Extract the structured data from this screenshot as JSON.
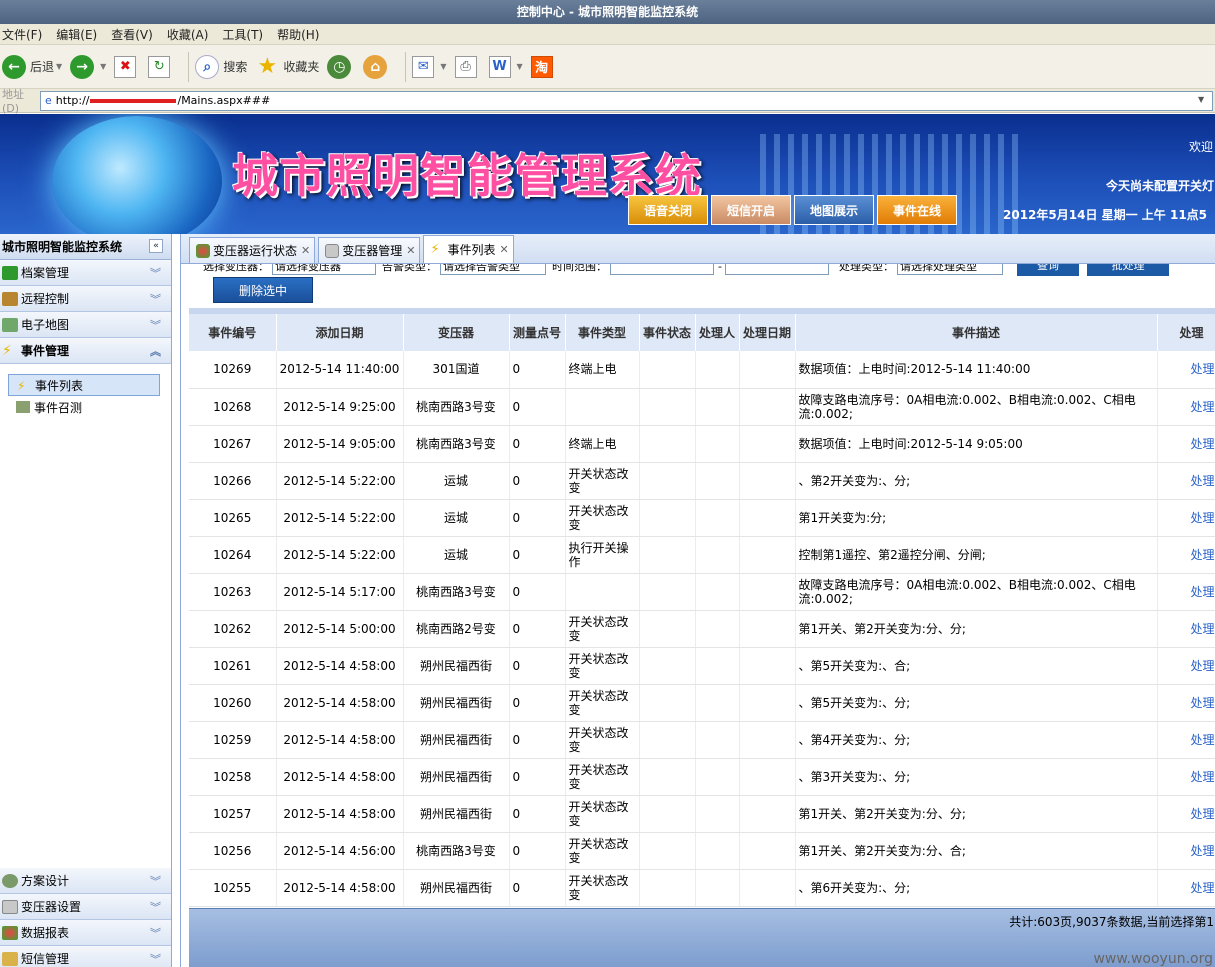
{
  "window": {
    "title": "控制中心 - 城市照明智能监控系统"
  },
  "menu": [
    "文件(F)",
    "编辑(E)",
    "查看(V)",
    "收藏(A)",
    "工具(T)",
    "帮助(H)"
  ],
  "toolbar": {
    "back": "后退",
    "search": "搜索",
    "favorites": "收藏夹"
  },
  "address": {
    "label": "地址(D)",
    "prefix": "http://",
    "suffix": "/Mains.aspx###"
  },
  "banner": {
    "title": "城市照明智能管理系统",
    "welcome": "欢迎",
    "notice": "今天尚未配置开关灯",
    "date": "2012年5月14日 星期一 上午 11点5",
    "buttons": [
      "语音关闭",
      "短信开启",
      "地图展示",
      "事件在线"
    ]
  },
  "sidebar": {
    "title": "城市照明智能监控系统",
    "sections_top": [
      "档案管理",
      "远程控制",
      "电子地图",
      "事件管理"
    ],
    "tree": [
      "事件列表",
      "事件召测"
    ],
    "sections_bottom": [
      "方案设计",
      "变压器设置",
      "数据报表",
      "短信管理"
    ]
  },
  "tabs": [
    "变压器运行状态",
    "变压器管理",
    "事件列表"
  ],
  "filter": {
    "l1": "选择变压器：",
    "s1": "请选择变压器",
    "l2": "告警类型：",
    "s2": "请选择告警类型",
    "l3": "时间范围：",
    "dash": "-",
    "l4": "处理类型：",
    "s4": "请选择处理类型",
    "query": "查询",
    "batch": "批处理",
    "delete": "删除选中"
  },
  "table": {
    "headers": [
      "事件编号",
      "添加日期",
      "变压器",
      "测量点号",
      "事件类型",
      "事件状态",
      "处理人",
      "处理日期",
      "事件描述",
      "处理"
    ],
    "rows": [
      [
        "10269",
        "2012-5-14 11:40:00",
        "301国道",
        "0",
        "终端上电",
        "",
        "",
        "",
        "数据项值：上电时间:2012-5-14 11:40:00",
        "处理"
      ],
      [
        "10268",
        "2012-5-14 9:25:00",
        "桃南西路3号变",
        "0",
        "",
        "",
        "",
        "",
        "故障支路电流序号：0A相电流:0.002、B相电流:0.002、C相电流:0.002;",
        "处理"
      ],
      [
        "10267",
        "2012-5-14 9:05:00",
        "桃南西路3号变",
        "0",
        "终端上电",
        "",
        "",
        "",
        "数据项值：上电时间:2012-5-14 9:05:00",
        "处理"
      ],
      [
        "10266",
        "2012-5-14 5:22:00",
        "运城",
        "0",
        "开关状态改变",
        "",
        "",
        "",
        "、第2开关变为:、分;",
        "处理"
      ],
      [
        "10265",
        "2012-5-14 5:22:00",
        "运城",
        "0",
        "开关状态改变",
        "",
        "",
        "",
        "第1开关变为:分;",
        "处理"
      ],
      [
        "10264",
        "2012-5-14 5:22:00",
        "运城",
        "0",
        "执行开关操作",
        "",
        "",
        "",
        "控制第1遥控、第2遥控分闸、分闸;",
        "处理"
      ],
      [
        "10263",
        "2012-5-14 5:17:00",
        "桃南西路3号变",
        "0",
        "",
        "",
        "",
        "",
        "故障支路电流序号：0A相电流:0.002、B相电流:0.002、C相电流:0.002;",
        "处理"
      ],
      [
        "10262",
        "2012-5-14 5:00:00",
        "桃南西路2号变",
        "0",
        "开关状态改变",
        "",
        "",
        "",
        "第1开关、第2开关变为:分、分;",
        "处理"
      ],
      [
        "10261",
        "2012-5-14 4:58:00",
        "朔州民福西街",
        "0",
        "开关状态改变",
        "",
        "",
        "",
        "、第5开关变为:、合;",
        "处理"
      ],
      [
        "10260",
        "2012-5-14 4:58:00",
        "朔州民福西街",
        "0",
        "开关状态改变",
        "",
        "",
        "",
        "、第5开关变为:、分;",
        "处理"
      ],
      [
        "10259",
        "2012-5-14 4:58:00",
        "朔州民福西街",
        "0",
        "开关状态改变",
        "",
        "",
        "",
        "、第4开关变为:、分;",
        "处理"
      ],
      [
        "10258",
        "2012-5-14 4:58:00",
        "朔州民福西街",
        "0",
        "开关状态改变",
        "",
        "",
        "",
        "、第3开关变为:、分;",
        "处理"
      ],
      [
        "10257",
        "2012-5-14 4:58:00",
        "朔州民福西街",
        "0",
        "开关状态改变",
        "",
        "",
        "",
        "第1开关、第2开关变为:分、分;",
        "处理"
      ],
      [
        "10256",
        "2012-5-14 4:56:00",
        "桃南西路3号变",
        "0",
        "开关状态改变",
        "",
        "",
        "",
        "第1开关、第2开关变为:分、合;",
        "处理"
      ],
      [
        "10255",
        "2012-5-14 4:58:00",
        "朔州民福西街",
        "0",
        "开关状态改变",
        "",
        "",
        "",
        "、第6开关变为:、分;",
        "处理"
      ]
    ]
  },
  "pager": {
    "summary": "共计:603页,9037条数据,当前选择第1"
  },
  "watermark": "www.wooyun.org",
  "colors": {
    "banner": "#1d4fb8",
    "header": "#dfe8f6",
    "link": "#2a62c9",
    "title_pink": "#ff4fa3"
  }
}
